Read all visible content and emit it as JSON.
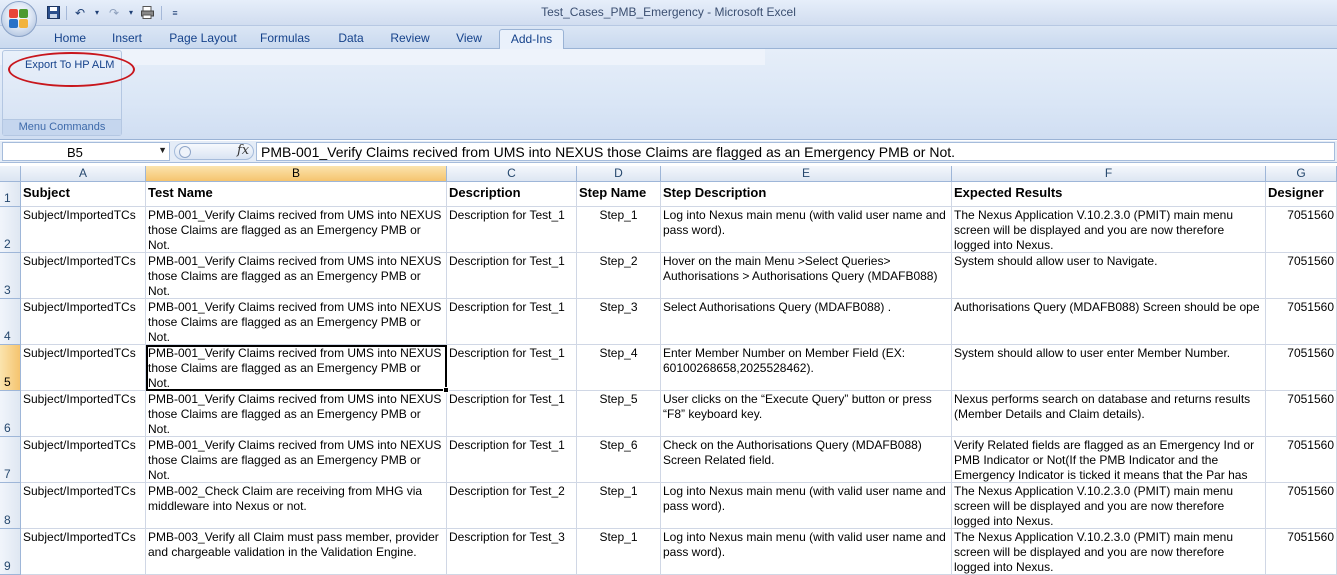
{
  "window": {
    "title": "Test_Cases_PMB_Emergency - Microsoft Excel"
  },
  "icons": {
    "office": "office-logo-icon",
    "save": "save-icon",
    "undo": "undo-icon",
    "redo": "redo-icon",
    "print": "print-preview-icon",
    "customize": "customize-arrow-icon"
  },
  "ribbon": {
    "tabs": [
      "Home",
      "Insert",
      "Page Layout",
      "Formulas",
      "Data",
      "Review",
      "View",
      "Add-Ins"
    ],
    "active_tab": "Add-Ins",
    "group": {
      "button": "Export To HP ALM",
      "label": "Menu Commands"
    }
  },
  "formula_bar": {
    "name_box": "B5",
    "fx": "fx",
    "formula": "PMB-001_Verify Claims recived from UMS into NEXUS those Claims  are flagged as an Emergency PMB or Not."
  },
  "sheet": {
    "active_cell": "B5",
    "columns": [
      "A",
      "B",
      "C",
      "D",
      "E",
      "F",
      "G"
    ],
    "row_numbers": [
      "1",
      "2",
      "3",
      "4",
      "5",
      "6",
      "7",
      "8",
      "9"
    ],
    "header_row": [
      "Subject",
      "Test Name",
      "Description",
      "Step Name",
      "Step Description",
      "Expected Results",
      "Designer"
    ],
    "rows": [
      [
        "Subject/ImportedTCs",
        "PMB-001_Verify Claims recived from UMS into NEXUS those Claims  are flagged as an Emergency PMB or Not.",
        "Description for Test_1",
        "Step_1",
        "Log into Nexus main menu (with valid user name and pass word).",
        "The Nexus Application V.10.2.3.0 (PMIT) main menu screen will be displayed and you are now therefore logged into Nexus.",
        "7051560"
      ],
      [
        "Subject/ImportedTCs",
        "PMB-001_Verify Claims recived from UMS into NEXUS those Claims  are flagged as an Emergency PMB or Not.",
        "Description for Test_1",
        "Step_2",
        "Hover on the main Menu >Select Queries> Authorisations > Authorisations Query (MDAFB088)",
        "System should allow user to Navigate.",
        "7051560"
      ],
      [
        "Subject/ImportedTCs",
        "PMB-001_Verify Claims recived from UMS into NEXUS those Claims  are flagged as an Emergency PMB or Not.",
        "Description for Test_1",
        "Step_3",
        "Select Authorisations Query (MDAFB088) .",
        "Authorisations Query (MDAFB088) Screen should be ope",
        "7051560"
      ],
      [
        "Subject/ImportedTCs",
        "PMB-001_Verify Claims recived from UMS into NEXUS those Claims  are flagged as an Emergency PMB or Not.",
        "Description for Test_1",
        "Step_4",
        "Enter Member Number on Member Field (EX: 60100268658,2025528462).",
        "System should allow to user enter Member Number.",
        "7051560"
      ],
      [
        "Subject/ImportedTCs",
        "PMB-001_Verify Claims recived from UMS into NEXUS those Claims  are flagged as an Emergency PMB or Not.",
        "Description for Test_1",
        "Step_5",
        "User clicks on the “Execute Query” button or press “F8” keyboard key.",
        "Nexus performs search on database and returns results (Member Details and Claim details).",
        "7051560"
      ],
      [
        "Subject/ImportedTCs",
        "PMB-001_Verify Claims recived from UMS into NEXUS those Claims  are flagged as an Emergency PMB or Not.",
        "Description for Test_1",
        "Step_6",
        "Check on the Authorisations Query (MDAFB088) Screen Related field.",
        "Verify Related fields are flagged as an Emergency Ind or PMB Indicator or Not(If the PMB Indicator and the Emergency Indicator is ticked it means that the Par has",
        "7051560"
      ],
      [
        "Subject/ImportedTCs",
        "PMB-002_Check Claim are receiving from MHG via middleware into Nexus or not.",
        "Description for Test_2",
        "Step_1",
        "Log into Nexus main menu (with valid user name and pass word).",
        "The Nexus Application V.10.2.3.0 (PMIT) main menu screen will be displayed and you are now therefore logged into Nexus.",
        "7051560"
      ],
      [
        "Subject/ImportedTCs",
        "PMB-003_Verify all Claim must pass member, provider and chargeable validation in the Validation Engine.",
        "Description for Test_3",
        "Step_1",
        "Log into Nexus main menu (with valid user name and pass word).",
        "The Nexus Application V.10.2.3.0 (PMIT) main menu screen will be displayed and you are now therefore logged into Nexus.",
        "7051560"
      ]
    ]
  }
}
